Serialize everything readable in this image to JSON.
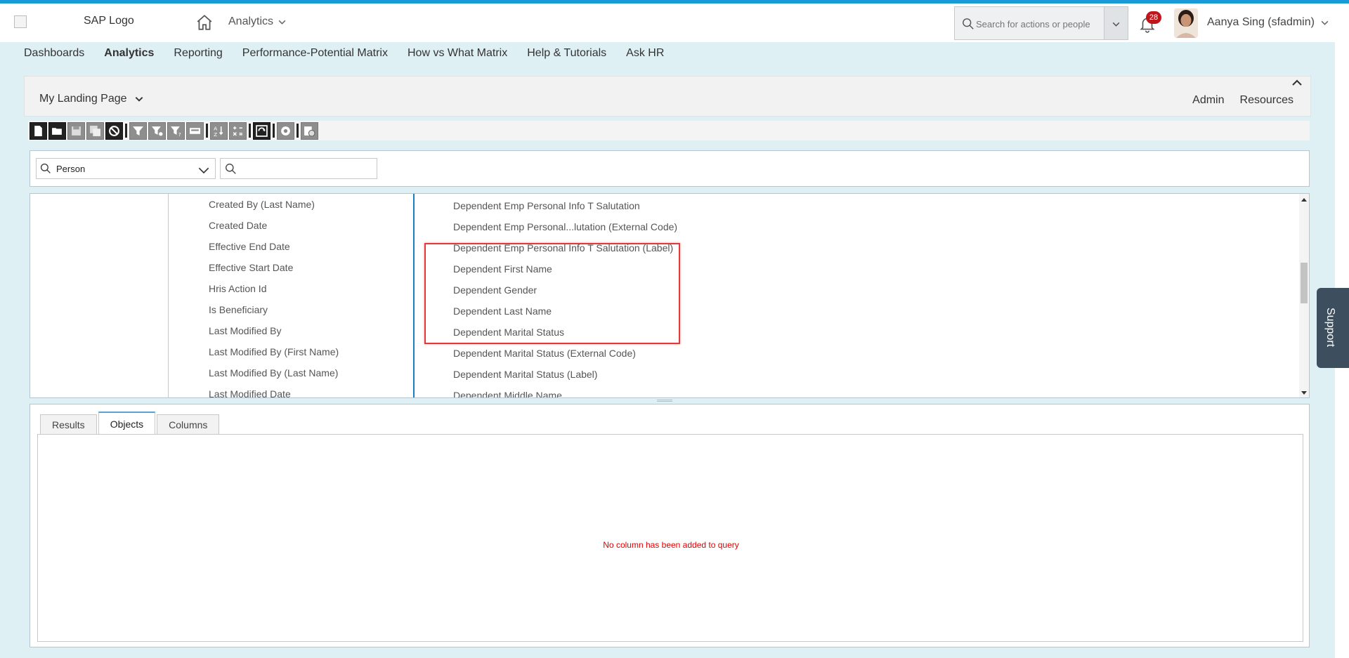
{
  "header": {
    "logo_text": "SAP Logo",
    "module": "Analytics",
    "search_placeholder": "Search for actions or people",
    "notification_count": "28",
    "user_name": "Aanya Sing (sfadmin)"
  },
  "nav": {
    "items": [
      "Dashboards",
      "Analytics",
      "Reporting",
      "Performance-Potential Matrix",
      "How vs What Matrix",
      "Help & Tutorials",
      "Ask HR"
    ],
    "active": "Analytics"
  },
  "landing": {
    "title": "My Landing Page",
    "admin": "Admin",
    "resources": "Resources"
  },
  "query": {
    "entity": "Person",
    "field_search_placeholder": ""
  },
  "fields": {
    "middle": [
      "Created By (Last Name)",
      "Created Date",
      "Effective End Date",
      "Effective Start Date",
      "Hris Action Id",
      "Is Beneficiary",
      "Last Modified By",
      "Last Modified By (First Name)",
      "Last Modified By (Last Name)",
      "Last Modified Date"
    ],
    "right": [
      "Dependent Emp Personal Info T Salutation",
      "Dependent Emp Personal...lutation (External Code)",
      "Dependent Emp Personal Info T Salutation (Label)",
      "Dependent First Name",
      "Dependent Gender",
      "Dependent Last Name",
      "Dependent Marital Status",
      "Dependent Marital Status (External Code)",
      "Dependent Marital Status (Label)",
      "Dependent Middle Name"
    ]
  },
  "tabs": {
    "results": "Results",
    "objects": "Objects",
    "columns": "Columns",
    "active": "Objects"
  },
  "empty_message": "No column has been added to query",
  "support_label": "Support",
  "colors": {
    "accent": "#1a9ad6",
    "shell_bg": "#dff0f5",
    "highlight": "#e03a3a",
    "badge": "#c0161b"
  }
}
